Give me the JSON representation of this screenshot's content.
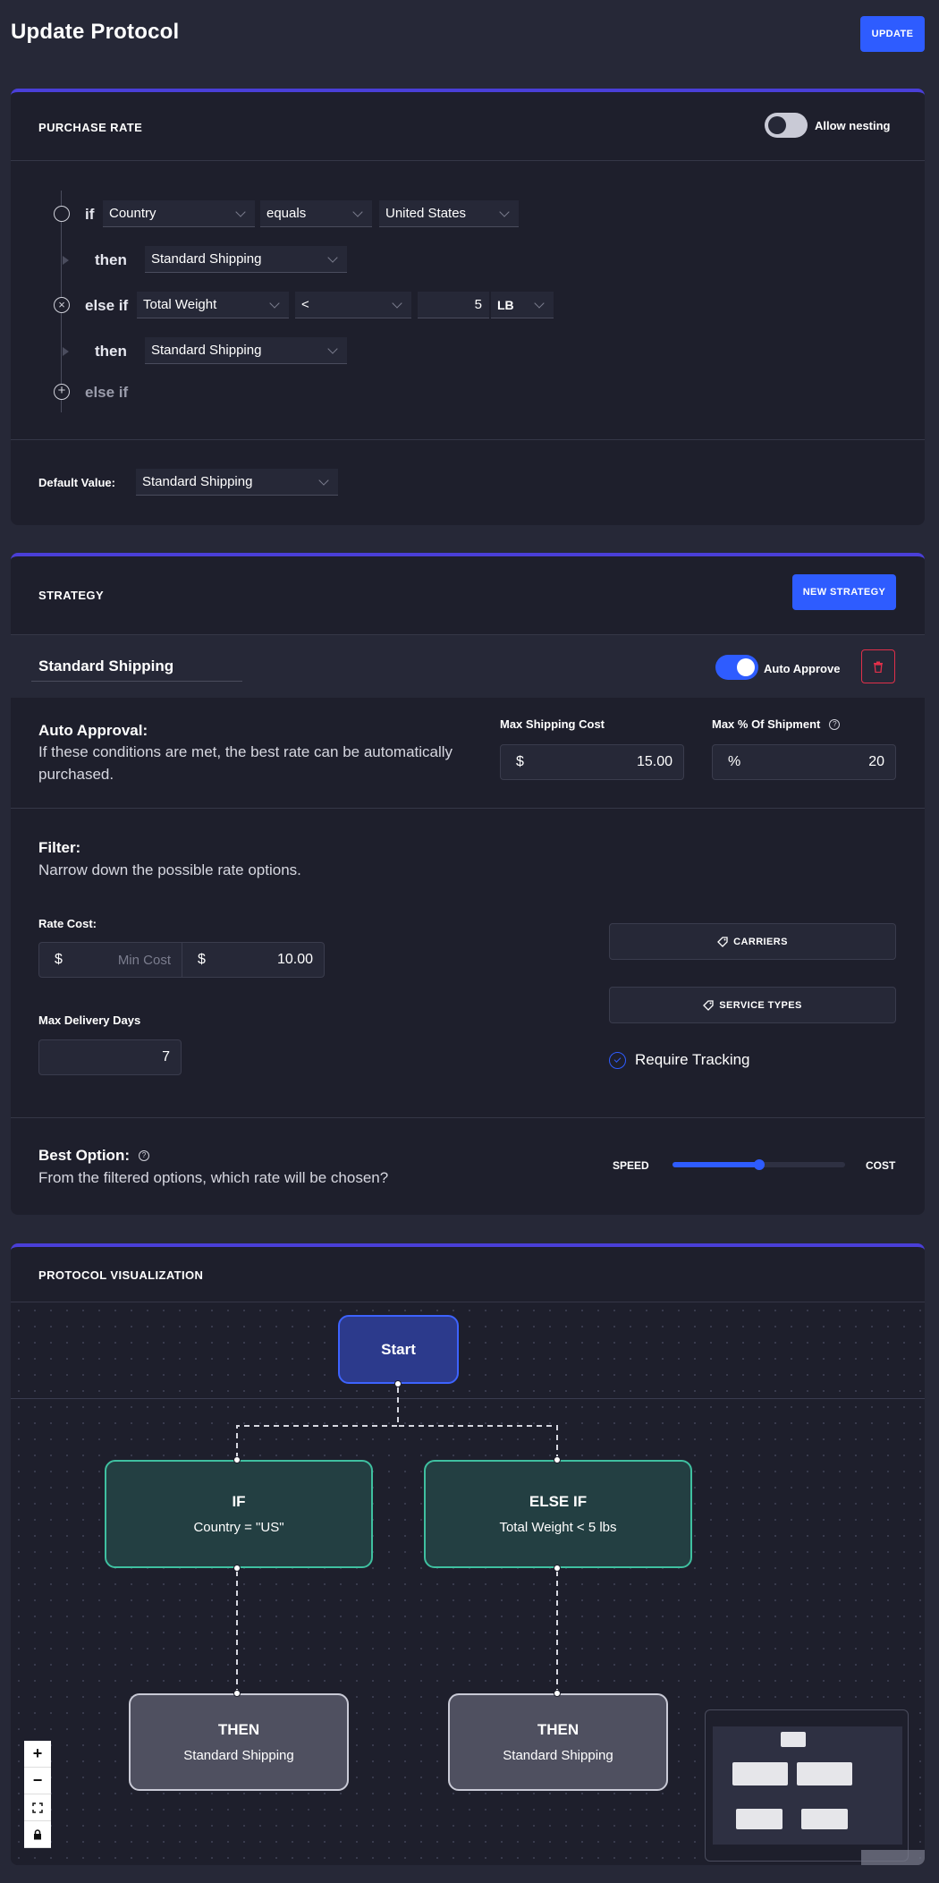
{
  "header": {
    "title": "Update Protocol",
    "update_label": "UPDATE"
  },
  "purchase_rate": {
    "title": "PURCHASE RATE",
    "allow_nesting_label": "Allow nesting",
    "allow_nesting_on": false,
    "rules": {
      "if_label": "if",
      "then_label": "then",
      "else_if_label": "else if",
      "rule1": {
        "field": "Country",
        "operator": "equals",
        "value": "United States",
        "then": "Standard Shipping"
      },
      "rule2": {
        "field": "Total Weight",
        "operator": "<",
        "value": "5",
        "unit": "LB",
        "then": "Standard Shipping"
      },
      "add_label": "else if"
    },
    "default_label": "Default Value:",
    "default_value": "Standard Shipping"
  },
  "strategy": {
    "title": "STRATEGY",
    "new_label": "NEW STRATEGY",
    "name": "Standard Shipping",
    "auto_approve_label": "Auto Approve",
    "auto_approve_on": true,
    "auto_approval": {
      "title": "Auto Approval:",
      "desc": "If these conditions are met, the best rate can be automatically purchased.",
      "max_cost_label": "Max Shipping Cost",
      "max_cost_prefix": "$",
      "max_cost_value": "15.00",
      "max_pct_label": "Max % Of Shipment",
      "max_pct_prefix": "%",
      "max_pct_value": "20"
    },
    "filter": {
      "title": "Filter:",
      "desc": "Narrow down the possible rate options.",
      "rate_cost_label": "Rate Cost:",
      "min_prefix": "$",
      "min_placeholder": "Min Cost",
      "max_prefix": "$",
      "max_value": "10.00",
      "carriers_label": "CARRIERS",
      "service_types_label": "SERVICE TYPES",
      "max_days_label": "Max Delivery Days",
      "max_days_value": "7",
      "require_tracking_label": "Require Tracking",
      "require_tracking_on": true
    },
    "best_option": {
      "title": "Best Option:",
      "desc": "From the filtered options, which rate will be chosen?",
      "speed_label": "SPEED",
      "cost_label": "COST",
      "slider_value": 0.5
    }
  },
  "visualization": {
    "title": "PROTOCOL VISUALIZATION",
    "nodes": {
      "start": "Start",
      "if_title": "IF",
      "if_sub": "Country = \"US\"",
      "elseif_title": "ELSE IF",
      "elseif_sub": "Total Weight < 5 lbs",
      "then1_title": "THEN",
      "then1_sub": "Standard Shipping",
      "then2_title": "THEN",
      "then2_sub": "Standard Shipping"
    },
    "controls": [
      "zoom-in",
      "zoom-out",
      "fit-view",
      "lock"
    ]
  },
  "colors": {
    "accent": "#2e5cff",
    "card_top_border": "#4a3fd8",
    "start_node": "#2c3a8c",
    "condition_node": "#3fc0a0",
    "then_node": "#5a5b6a",
    "danger": "#e0304a"
  }
}
